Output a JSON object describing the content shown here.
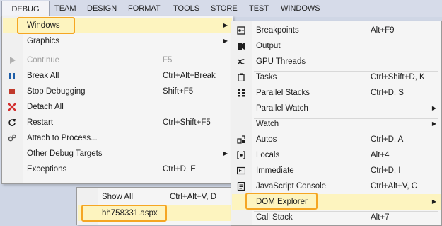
{
  "menubar": [
    "DEBUG",
    "TEAM",
    "DESIGN",
    "FORMAT",
    "TOOLS",
    "STORE",
    "TEST",
    "WINDOWS"
  ],
  "debug_menu": [
    {
      "label": "Windows",
      "shortcut": "",
      "submenu": true,
      "icon": "",
      "highlight": true
    },
    {
      "label": "Graphics",
      "shortcut": "",
      "submenu": true,
      "icon": ""
    },
    {
      "label": "Continue",
      "shortcut": "F5",
      "icon": "play-icon",
      "disabled": true
    },
    {
      "label": "Break All",
      "shortcut": "Ctrl+Alt+Break",
      "icon": "pause-icon"
    },
    {
      "label": "Stop Debugging",
      "shortcut": "Shift+F5",
      "icon": "stop-icon"
    },
    {
      "label": "Detach All",
      "shortcut": "",
      "icon": "x-icon"
    },
    {
      "label": "Restart",
      "shortcut": "Ctrl+Shift+F5",
      "icon": "restart-icon"
    },
    {
      "label": "Attach to Process...",
      "shortcut": "",
      "icon": "gears-icon"
    },
    {
      "label": "Other Debug Targets",
      "shortcut": "",
      "submenu": true,
      "icon": ""
    },
    {
      "label": "Exceptions",
      "shortcut": "Ctrl+D, E",
      "icon": ""
    }
  ],
  "windows_menu": [
    {
      "label": "Breakpoints",
      "shortcut": "Alt+F9",
      "icon": "breakpoints-icon"
    },
    {
      "label": "Output",
      "shortcut": "",
      "icon": "output-icon"
    },
    {
      "label": "GPU Threads",
      "shortcut": "",
      "icon": "gpu-threads-icon"
    },
    {
      "label": "Tasks",
      "shortcut": "Ctrl+Shift+D, K",
      "icon": "clipboard-icon"
    },
    {
      "label": "Parallel Stacks",
      "shortcut": "Ctrl+D, S",
      "icon": "parallel-stacks-icon"
    },
    {
      "label": "Parallel Watch",
      "shortcut": "",
      "submenu": true,
      "icon": ""
    },
    {
      "label": "Watch",
      "shortcut": "",
      "submenu": true,
      "icon": ""
    },
    {
      "label": "Autos",
      "shortcut": "Ctrl+D, A",
      "icon": "autos-icon"
    },
    {
      "label": "Locals",
      "shortcut": "Alt+4",
      "icon": "locals-icon"
    },
    {
      "label": "Immediate",
      "shortcut": "Ctrl+D, I",
      "icon": "immediate-icon"
    },
    {
      "label": "JavaScript Console",
      "shortcut": "Ctrl+Alt+V, C",
      "icon": "js-console-icon"
    },
    {
      "label": "DOM Explorer",
      "shortcut": "",
      "submenu": true,
      "icon": "",
      "highlight": true
    },
    {
      "label": "Call Stack",
      "shortcut": "Alt+7",
      "icon": "call-stack-icon"
    }
  ],
  "dom_menu": [
    {
      "label": "Show All",
      "shortcut": "Ctrl+Alt+V, D"
    },
    {
      "label": "hh758331.aspx",
      "shortcut": "",
      "highlight": true
    }
  ],
  "colors": {
    "highlight": "#fdf4bf",
    "callout": "#f5a623",
    "stop": "#c0392b",
    "detach": "#d32f2f",
    "pause": "#1f5ea8"
  }
}
